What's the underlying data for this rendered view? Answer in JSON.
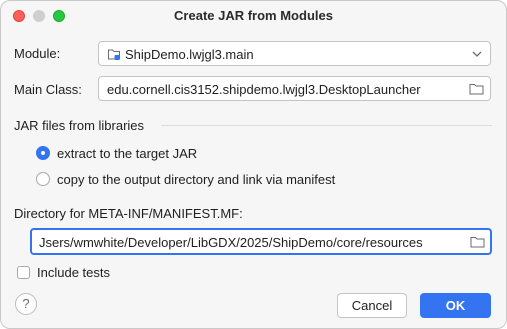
{
  "window": {
    "title": "Create JAR from Modules"
  },
  "module": {
    "label": "Module:",
    "value": "ShipDemo.lwjgl3.main",
    "icon": "module-folder-icon"
  },
  "main_class": {
    "label": "Main Class:",
    "value": "edu.cornell.cis3152.shipdemo.lwjgl3.DesktopLauncher",
    "icon": "folder-icon"
  },
  "jar_files": {
    "section_label": "JAR files from libraries",
    "options": [
      {
        "label": "extract to the target JAR",
        "selected": true
      },
      {
        "label": "copy to the output directory and link via manifest",
        "selected": false
      }
    ]
  },
  "manifest_dir": {
    "label": "Directory for META-INF/MANIFEST.MF:",
    "value": "Jsers/wmwhite/Developer/LibGDX/2025/ShipDemo/core/resources",
    "icon": "folder-icon"
  },
  "include_tests": {
    "label": "Include tests",
    "checked": false
  },
  "buttons": {
    "help": "?",
    "cancel": "Cancel",
    "ok": "OK"
  },
  "colors": {
    "accent": "#3574f0",
    "close": "#ff5f57",
    "maximize": "#28c840"
  }
}
